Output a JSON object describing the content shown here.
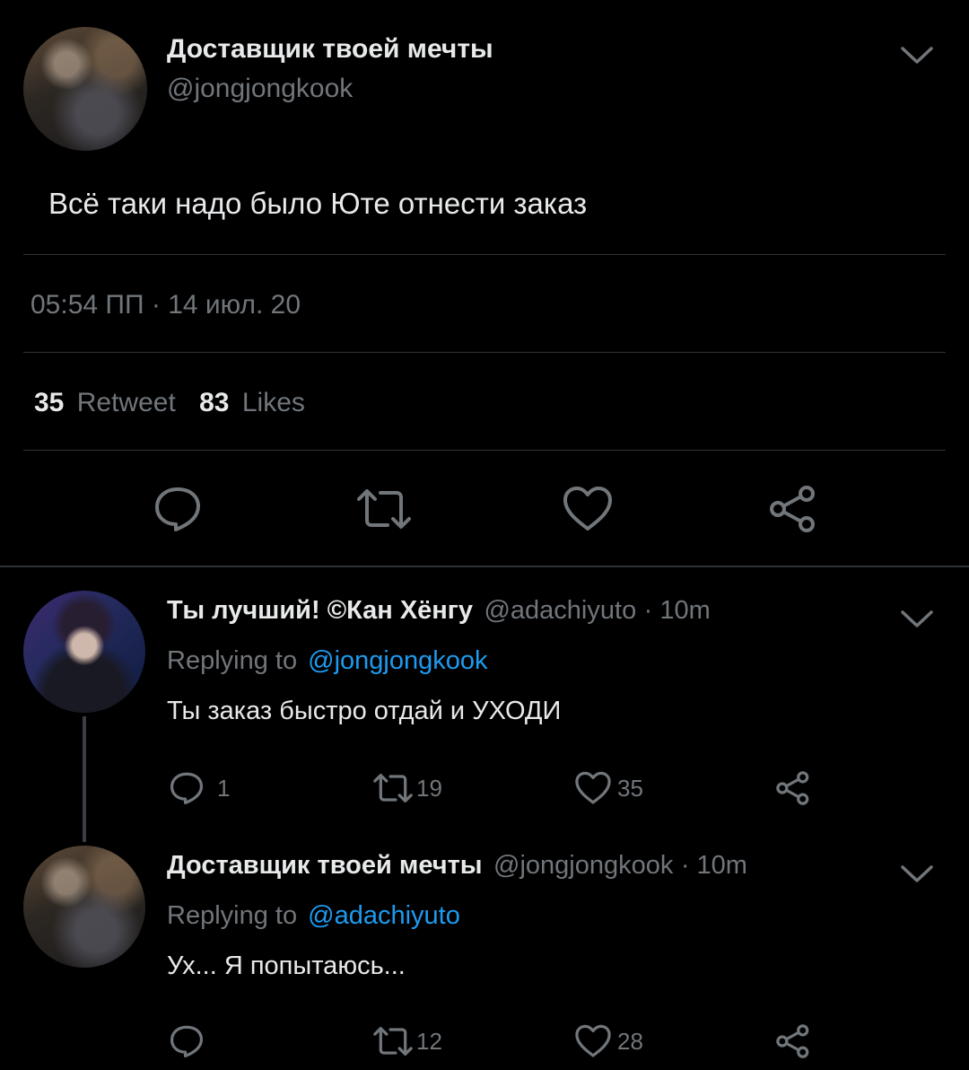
{
  "main_tweet": {
    "display_name": "Доставщик твоей мечты",
    "handle": "@jongjongkook",
    "text": "Всё таки надо было Юте отнести заказ",
    "timestamp": "05:54 ПП · 14 июл. 20",
    "retweets_count": "35",
    "retweets_label": "Retweet",
    "likes_count": "83",
    "likes_label": "Likes",
    "icons": [
      "reply-icon",
      "retweet-icon",
      "like-icon",
      "share-icon"
    ]
  },
  "replies": [
    {
      "display_name": "Ты лучший! ©Кан Хёнгу",
      "handle": "@adachiyuto",
      "time": "· 10m",
      "replying_prefix": "Replying to",
      "replying_to": "@jongjongkook",
      "text": "Ты заказ быстро отдай и УХОДИ",
      "reply_count": "1",
      "retweet_count": "19",
      "like_count": "35"
    },
    {
      "display_name": "Доставщик твоей мечты",
      "handle": "@jongjongkook",
      "time": "· 10m",
      "replying_prefix": "Replying to",
      "replying_to": "@adachiyuto",
      "text": "Ух... Я попытаюсь...",
      "reply_count": "",
      "retweet_count": "12",
      "like_count": "28"
    }
  ],
  "colors": {
    "background": "#000000",
    "text": "#e7e9ea",
    "muted": "#71767b",
    "link": "#1d9bf0",
    "divider": "#2f3336"
  }
}
